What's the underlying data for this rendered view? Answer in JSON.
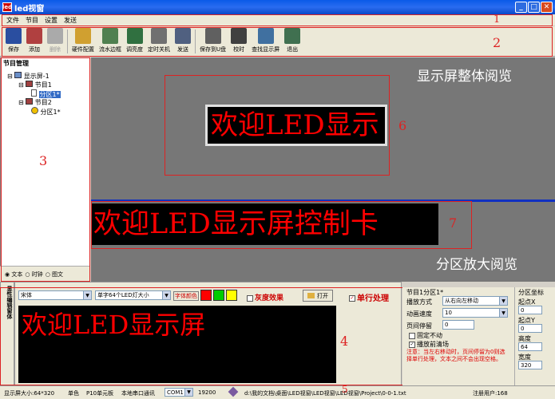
{
  "window": {
    "title": "led视窗",
    "app_icon": "led",
    "min_icon": "minimize-icon",
    "max_icon": "maximize-icon",
    "close_icon": "close-icon"
  },
  "menu": [
    "文件",
    "节目",
    "设置",
    "发送"
  ],
  "toolbar": [
    {
      "label": "保存",
      "icon": "save-icon",
      "color": "#2a4ea0"
    },
    {
      "label": "添加",
      "icon": "add-icon",
      "color": "#b04040"
    },
    {
      "label": "删除",
      "icon": "delete-icon",
      "color": "#aaaaaa",
      "disabled": true
    },
    {
      "label": "硬件配置",
      "icon": "hardware-icon",
      "color": "#d0a030"
    },
    {
      "label": "流水边框",
      "icon": "border-icon",
      "color": "#508050"
    },
    {
      "label": "调亮度",
      "icon": "brightness-icon",
      "color": "#307040"
    },
    {
      "label": "定时关机",
      "icon": "timer-shutdown-icon",
      "color": "#707070"
    },
    {
      "label": "发送",
      "icon": "send-icon",
      "color": "#506080"
    },
    {
      "label": "保存到U盘",
      "icon": "usb-icon",
      "color": "#606060"
    },
    {
      "label": "校时",
      "icon": "clock-icon",
      "color": "#404040"
    },
    {
      "label": "查找显示屏",
      "icon": "find-screen-icon",
      "color": "#4070a0"
    },
    {
      "label": "退出",
      "icon": "exit-icon",
      "color": "#407050"
    }
  ],
  "tree": {
    "header": "节目管理",
    "items": [
      {
        "label": "显示屏-1",
        "icon": "screen-icon"
      },
      {
        "label": "节目1",
        "icon": "program-icon"
      },
      {
        "label": "分区1*",
        "icon": "text-zone-icon",
        "selected": true
      },
      {
        "label": "节目2",
        "icon": "program-icon"
      },
      {
        "label": "分区1*",
        "icon": "clock-zone-icon"
      }
    ],
    "radios": [
      {
        "label": "文本",
        "checked": true
      },
      {
        "label": "时钟",
        "checked": false
      },
      {
        "label": "图文",
        "checked": false
      }
    ]
  },
  "preview": {
    "overall_label": "显示屏整体阅览",
    "zoom_label": "分区放大阅览",
    "screen_text": "欢迎LED显示",
    "zone_text": "欢迎LED显示屏控制卡"
  },
  "annotations": [
    "1",
    "2",
    "3",
    "4",
    "5",
    "6",
    "7"
  ],
  "editor": {
    "side_label": "显性编辑窗体",
    "font": "宋体",
    "font_size": "单字64个LED灯大小",
    "font_color_label": "字体颜色",
    "colors": [
      "#ff0000",
      "#00cc00",
      "#ffff00"
    ],
    "grey_label": "灰度效果",
    "open_label": "打开",
    "single_line_label": "单行处理",
    "single_line_checked": true,
    "text": "欢迎LED显示屏"
  },
  "props": {
    "title": "节目1分区1*",
    "play_mode_label": "播放方式",
    "play_mode": "从右向左移动",
    "speed_label": "动画速度",
    "speed": "10",
    "pause_label": "页间停留",
    "pause": "0",
    "fixed_label": "固定不动",
    "fixed_checked": false,
    "clear_label": "播放前清场",
    "clear_checked": true,
    "note": "注意：当左右移动时，页间停留为0则选择单行处理，文本之间不会出现空格。"
  },
  "coords": {
    "title": "分区坐标",
    "x_label": "起点X",
    "x": "0",
    "y_label": "起点Y",
    "y": "0",
    "h_label": "高度",
    "h": "64",
    "w_label": "宽度",
    "w": "320"
  },
  "status": {
    "screen_size": "显示屏大小:64*320",
    "color_mode": "单色",
    "board": "P10单元板",
    "comm": "本地串口通讯",
    "port": "COM1",
    "baud": "19200",
    "path": "d:\\我的文档\\桌面\\LED视窗\\LED视窗\\LED视窗\\Project\\0-0-1.txt",
    "user": "注册用户:168"
  }
}
